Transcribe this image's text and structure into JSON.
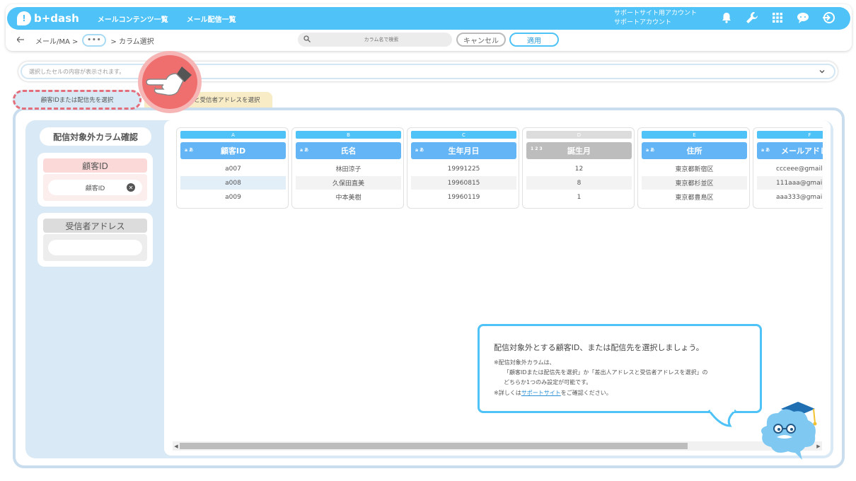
{
  "header": {
    "logo_text": "b+dash",
    "nav": [
      "メールコンテンツ一覧",
      "メール配信一覧"
    ],
    "account_line1": "サポートサイト用アカウント",
    "account_line2": "サポートアカウント",
    "icons": [
      "bell-icon",
      "wrench-icon",
      "grid-icon",
      "chat-icon",
      "logout-icon"
    ]
  },
  "subbar": {
    "crumb_root": "メール/MA >",
    "crumb_more": "•••",
    "crumb_current": "> カラム選択",
    "search_placeholder": "カラム名で検索",
    "cancel_label": "キャンセル",
    "apply_label": "適用"
  },
  "infobar": {
    "placeholder": "選択したセルの内容が表示されます。"
  },
  "tabs": {
    "tab1": "顧客IDまたは配信先を選択",
    "tab2": "と受信者アドレスを選択"
  },
  "left_panel": {
    "title": "配信対象外カラム確認",
    "box1_head": "顧客ID",
    "box1_chip": "顧客ID",
    "box2_head": "受信者アドレス"
  },
  "columns": [
    {
      "letter": "A",
      "type": "a あ",
      "name": "顧客ID",
      "rows": [
        "a007",
        "a008",
        "a009"
      ],
      "style": "blue"
    },
    {
      "letter": "B",
      "type": "a あ",
      "name": "氏名",
      "rows": [
        "林田涼子",
        "久保田直美",
        "中本美樹"
      ],
      "style": "blue"
    },
    {
      "letter": "C",
      "type": "a あ",
      "name": "生年月日",
      "rows": [
        "19991225",
        "19960815",
        "19960119"
      ],
      "style": "blue"
    },
    {
      "letter": "D",
      "type": "1 2 3",
      "name": "誕生月",
      "rows": [
        "12",
        "8",
        "1"
      ],
      "style": "gray"
    },
    {
      "letter": "E",
      "type": "a あ",
      "name": "住所",
      "rows": [
        "東京都新宿区",
        "東京都杉並区",
        "東京都豊島区"
      ],
      "style": "blue"
    },
    {
      "letter": "F",
      "type": "a あ",
      "name": "メールアドレス",
      "rows": [
        "ccceee@gmail",
        "111aaa@gmail",
        "aaa333@gmail"
      ],
      "style": "blue"
    }
  ],
  "bubble": {
    "title": "配信対象外とする顧客ID、または配信先を選択しましょう。",
    "note1": "※配信対象外カラムは、",
    "note2": "「顧客IDまたは配信先を選択」か「差出人アドレスと受信者アドレスを選択」の",
    "note3": "どちらか1つのみ設定が可能です。",
    "note4_pre": "※詳しくは",
    "note4_link": "サポートサイト",
    "note4_post": "をご確認ください。"
  }
}
